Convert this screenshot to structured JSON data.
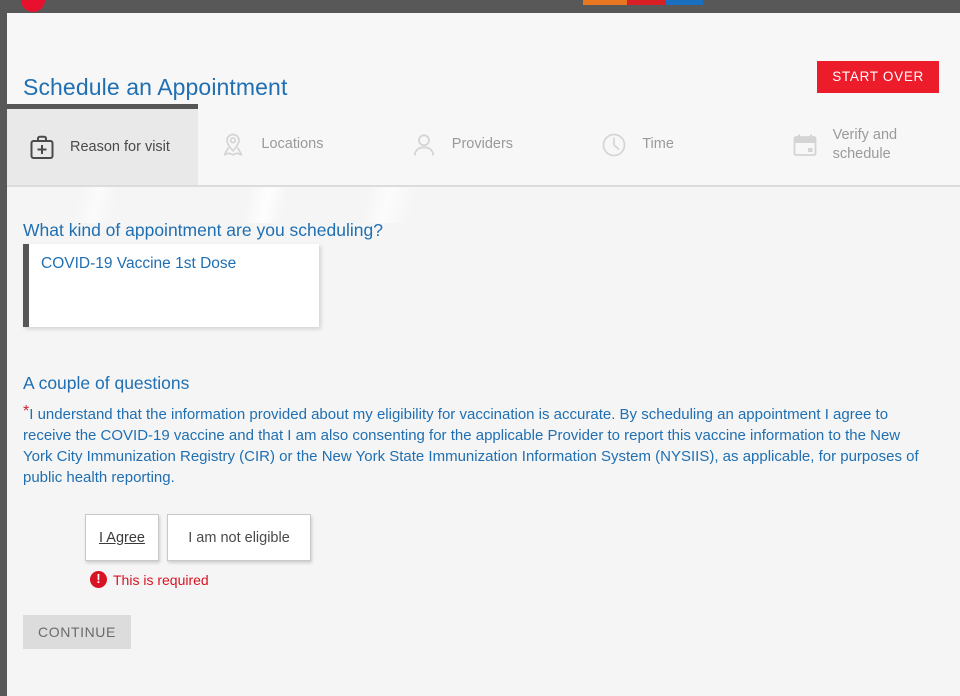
{
  "window": {
    "favicon": "red-circle-favicon",
    "color_bars": [
      "#e8771f",
      "#d81f26",
      "#1a6fc0"
    ]
  },
  "header": {
    "title": "Schedule an Appointment",
    "start_over_label": "START OVER"
  },
  "tabs": [
    {
      "label": "Reason for visit",
      "icon": "medical-bag-plus-icon",
      "active": true
    },
    {
      "label": "Locations",
      "icon": "map-pin-icon",
      "active": false
    },
    {
      "label": "Providers",
      "icon": "person-icon",
      "active": false
    },
    {
      "label": "Time",
      "icon": "clock-icon",
      "active": false
    },
    {
      "label": "Verify and schedule",
      "icon": "calendar-icon",
      "active": false
    }
  ],
  "content": {
    "question1_heading": "What kind of appointment are you scheduling?",
    "appointment_type": "COVID-19 Vaccine 1st Dose",
    "question2_heading": "A couple of questions",
    "consent_required_marker": "*",
    "consent_text": "I understand that the information provided about my eligibility for vaccination is accurate. By scheduling an appointment I agree to receive the COVID-19 vaccine and that I am also consenting for the applicable Provider to report this vaccine information to the New York City Immunization Registry (CIR) or the New York State Immunization Information System (NYSIIS), as applicable, for purposes of public health reporting.",
    "choice_agree_label": "I Agree",
    "choice_not_eligible_label": "I am not eligible",
    "validation_icon": "error-exclamation-icon",
    "validation_icon_glyph": "!",
    "validation_message": "This is required",
    "continue_label": "CONTINUE"
  },
  "colors": {
    "brand_blue": "#1f6fb2",
    "brand_red": "#ec1c2b",
    "error_red": "#d81324",
    "tab_active_bg": "#e9e9e9",
    "page_bg": "#f5f5f5"
  }
}
